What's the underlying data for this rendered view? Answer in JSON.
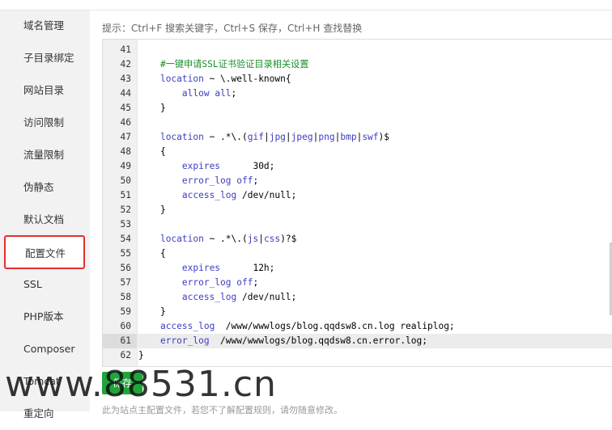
{
  "sidebar": {
    "items": [
      {
        "label": "域名管理"
      },
      {
        "label": "子目录绑定"
      },
      {
        "label": "网站目录"
      },
      {
        "label": "访问限制"
      },
      {
        "label": "流量限制"
      },
      {
        "label": "伪静态"
      },
      {
        "label": "默认文档"
      },
      {
        "label": "配置文件",
        "active": true
      },
      {
        "label": "SSL"
      },
      {
        "label": "PHP版本"
      },
      {
        "label": "Composer"
      },
      {
        "label": "Tomcat"
      },
      {
        "label": "重定向"
      }
    ]
  },
  "editor": {
    "hint": "提示：Ctrl+F 搜索关键字，Ctrl+S 保存，Ctrl+H 查找替换",
    "current_line": 61,
    "lines": [
      {
        "num": "41",
        "code": ""
      },
      {
        "num": "42",
        "code": "    #一键申请SSL证书验证目录相关设置"
      },
      {
        "num": "43",
        "code": "    location ~ \\.well-known{"
      },
      {
        "num": "44",
        "code": "        allow all;"
      },
      {
        "num": "45",
        "code": "    }"
      },
      {
        "num": "46",
        "code": ""
      },
      {
        "num": "47",
        "code": "    location ~ .*\\.(gif|jpg|jpeg|png|bmp|swf)$"
      },
      {
        "num": "48",
        "code": "    {"
      },
      {
        "num": "49",
        "code": "        expires      30d;"
      },
      {
        "num": "50",
        "code": "        error_log off;"
      },
      {
        "num": "51",
        "code": "        access_log /dev/null;"
      },
      {
        "num": "52",
        "code": "    }"
      },
      {
        "num": "53",
        "code": ""
      },
      {
        "num": "54",
        "code": "    location ~ .*\\.(js|css)?$"
      },
      {
        "num": "55",
        "code": "    {"
      },
      {
        "num": "56",
        "code": "        expires      12h;"
      },
      {
        "num": "57",
        "code": "        error_log off;"
      },
      {
        "num": "58",
        "code": "        access_log /dev/null;"
      },
      {
        "num": "59",
        "code": "    }"
      },
      {
        "num": "60",
        "code": "    access_log  /www/wwwlogs/blog.qqdsw8.cn.log realiplog;"
      },
      {
        "num": "61",
        "code": "    error_log  /www/wwwlogs/blog.qqdsw8.cn.error.log;"
      },
      {
        "num": "62",
        "code": "}"
      }
    ]
  },
  "footer": {
    "save_label": "保存",
    "note": "此为站点主配置文件，若您不了解配置规则，请勿随意修改。"
  },
  "watermark": "www.88531.cn",
  "colors": {
    "accent": "#20a53a",
    "active_border": "#e5302c",
    "keyword": "#3d3dc4",
    "comment": "#1b8d2d"
  }
}
